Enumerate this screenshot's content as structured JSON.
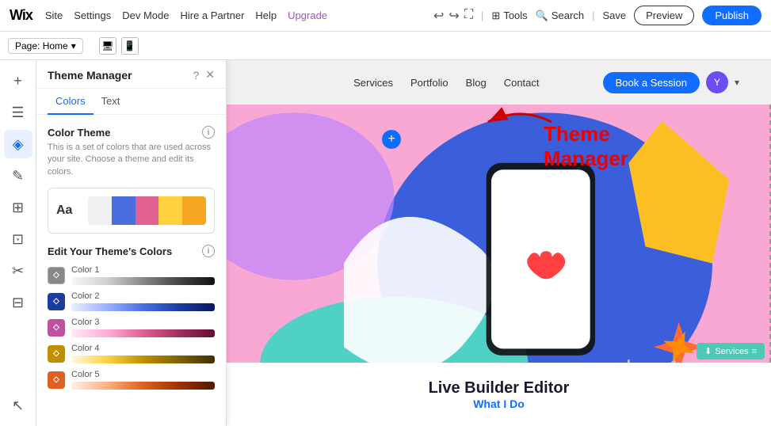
{
  "topbar": {
    "logo": "Wix",
    "nav": [
      "Site",
      "Settings",
      "Dev Mode",
      "Hire a Partner",
      "Help",
      "Upgrade"
    ],
    "upgrade_label": "Upgrade",
    "save_label": "Save",
    "preview_label": "Preview",
    "publish_label": "Publish",
    "tools_label": "Tools",
    "search_label": "Search",
    "page_label": "Page: Home"
  },
  "left_sidebar": {
    "icons": [
      {
        "name": "add-icon",
        "symbol": "+"
      },
      {
        "name": "pages-icon",
        "symbol": "☰"
      },
      {
        "name": "themes-icon",
        "symbol": "◈"
      },
      {
        "name": "design-icon",
        "symbol": "✎"
      },
      {
        "name": "apps-icon",
        "symbol": "⊞"
      },
      {
        "name": "media-icon",
        "symbol": "⊡"
      },
      {
        "name": "tools2-icon",
        "symbol": "✂"
      },
      {
        "name": "blog-icon",
        "symbol": "⊟"
      }
    ],
    "active_index": 2
  },
  "theme_panel": {
    "title": "Theme Manager",
    "tabs": [
      "Colors",
      "Text"
    ],
    "active_tab": "Colors",
    "color_theme": {
      "label": "Color Theme",
      "description": "This is a set of colors that are used across your site. Choose a theme and edit its colors.",
      "sample_label": "Aa",
      "swatches": [
        {
          "color": "#f0f0f0"
        },
        {
          "color": "#4a6ee0"
        },
        {
          "color": "#e06090"
        },
        {
          "color": "#ffd040"
        },
        {
          "color": "#f5a623"
        }
      ]
    },
    "edit_colors": {
      "label": "Edit Your Theme's Colors",
      "colors": [
        {
          "id": "color1",
          "label": "Color 1",
          "icon_bg": "#888",
          "icon_symbol": "◇",
          "gradient_class": "grad-1"
        },
        {
          "id": "color2",
          "label": "Color 2",
          "icon_bg": "#1a3ea0",
          "icon_symbol": "◇",
          "gradient_class": "grad-2"
        },
        {
          "id": "color3",
          "label": "Color 3",
          "icon_bg": "#c050a0",
          "icon_symbol": "◇",
          "gradient_class": "grad-3"
        },
        {
          "id": "color4",
          "label": "Color 4",
          "icon_bg": "#c09000",
          "icon_symbol": "◇",
          "gradient_class": "grad-4"
        },
        {
          "id": "color5",
          "label": "Color 5",
          "icon_bg": "#e06020",
          "icon_symbol": "◇",
          "gradient_class": "grad-5"
        }
      ]
    }
  },
  "site_nav": {
    "links": [
      "Services",
      "Portfolio",
      "Blog",
      "Contact"
    ],
    "cta_label": "Book a Session",
    "avatar_label": "Y"
  },
  "canvas": {
    "plus_symbol": "+",
    "annotation_text": "Theme Manager"
  },
  "bottom": {
    "title": "Live Builder Editor",
    "subtitle": "What I Do"
  },
  "services_float": {
    "label": "Services"
  }
}
